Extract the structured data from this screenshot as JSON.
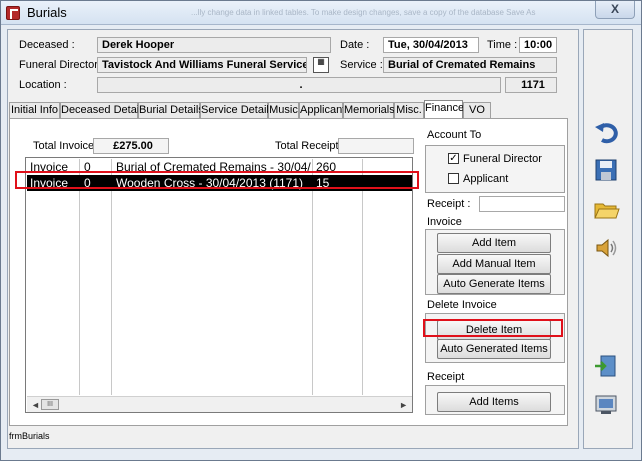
{
  "window": {
    "title": "Burials",
    "ghost_text": "...lly change data in linked tables. To make design changes, save a copy of the database    Save As",
    "close_symbol": "X"
  },
  "header": {
    "deceased_label": "Deceased :",
    "deceased_value": "Derek Hooper",
    "date_label": "Date :",
    "date_value": "Tue, 30/04/2013",
    "time_label": "Time :",
    "time_value": "10:00",
    "funeral_director_label": "Funeral Director :",
    "funeral_director_value": "Tavistock And Williams Funeral Services",
    "calendar_icon_text": "▦",
    "service_label": "Service :",
    "service_value": "Burial of Cremated Remains",
    "location_label": "Location :",
    "location_value": ".",
    "location_code": "1171"
  },
  "tabs": [
    "Initial Info",
    "Deceased Details",
    "Burial Details",
    "Service Details",
    "Music",
    "Applicant",
    "Memorials",
    "Misc.",
    "Finance",
    "VO"
  ],
  "active_tab": "Finance",
  "finance": {
    "total_invoice_label": "Total Invoice:",
    "total_invoice_value": "£275.00",
    "total_receipt_label": "Total Receipt:",
    "total_receipt_value": "",
    "rows": [
      {
        "type": "Invoice",
        "num": "0",
        "desc": "Burial of Cremated Remains -  30/04/",
        "amount": "260",
        "selected": false
      },
      {
        "type": "Invoice",
        "num": "0",
        "desc": "Wooden Cross -  30/04/2013 (1171)",
        "amount": "15",
        "selected": true
      }
    ],
    "scroll_thumb_text": "III",
    "account_to_label": "Account To",
    "funeral_director_check_label": "Funeral Director",
    "funeral_director_checked": true,
    "applicant_check_label": "Applicant",
    "applicant_checked": false,
    "receipt_label": "Receipt :",
    "receipt_value": "",
    "invoice_group_label": "Invoice",
    "add_item_label": "Add Item",
    "add_manual_item_label": "Add Manual Item",
    "auto_generate_label": "Auto Generate Items",
    "delete_invoice_label": "Delete Invoice",
    "delete_item_label": "Delete  Item",
    "auto_generated_items_label": "Auto Generated Items",
    "receipt_group_label": "Receipt",
    "add_items_label": "Add Items"
  },
  "footer": {
    "form_name": "frmBurials"
  },
  "colors": {
    "highlight": "#e0101a",
    "selection": "#000000"
  }
}
